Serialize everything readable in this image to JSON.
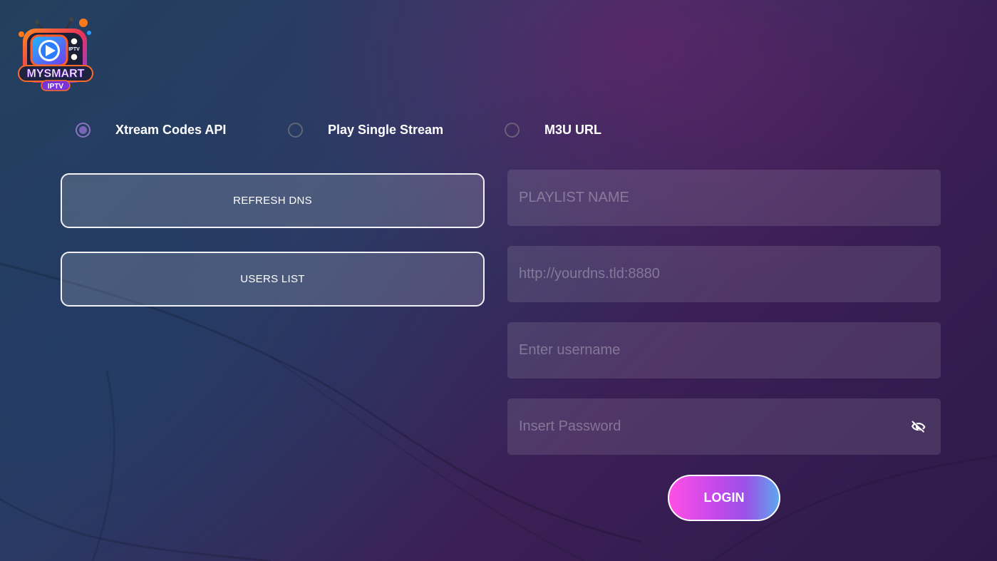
{
  "app": {
    "logo_text": "MYSMART",
    "logo_subtext": "IPTV",
    "logo_screen_text": "IPTV"
  },
  "login_type": {
    "options": [
      {
        "label": "Xtream Codes API",
        "selected": true
      },
      {
        "label": "Play Single Stream",
        "selected": false
      },
      {
        "label": "M3U URL",
        "selected": false
      }
    ]
  },
  "actions": {
    "refresh_dns_label": "REFRESH DNS",
    "users_list_label": "USERS LIST"
  },
  "form": {
    "playlist_name": {
      "value": "",
      "placeholder": "PLAYLIST NAME"
    },
    "url": {
      "value": "",
      "placeholder": "http://yourdns.tld:8880"
    },
    "username": {
      "value": "",
      "placeholder": "Enter username"
    },
    "password": {
      "value": "",
      "placeholder": "Insert Password",
      "visibility_icon": "eye-off-icon"
    },
    "login_label": "LOGIN"
  },
  "colors": {
    "accent": "#7a66b8",
    "login_gradient_start": "#ff4fe6",
    "login_gradient_end": "#5fa6ee"
  }
}
